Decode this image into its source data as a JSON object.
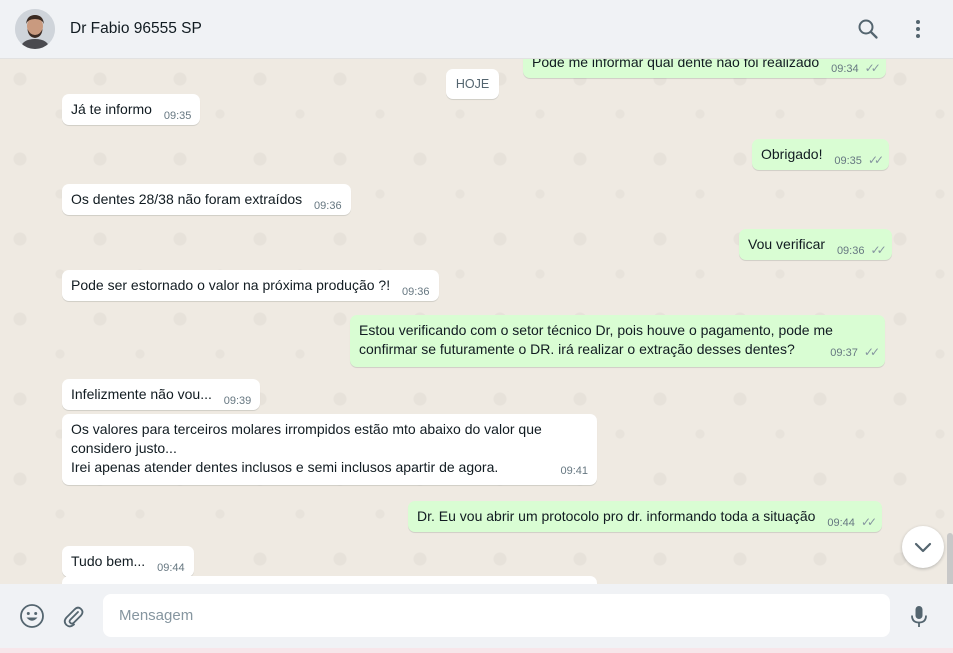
{
  "header": {
    "contact_name": "Dr Fabio 96555 SP"
  },
  "chat": {
    "date_chip": "HOJE",
    "top_partial_message": {
      "text": "Pode me informar qual dente não foi realizado",
      "time": "09:34"
    },
    "messages": [
      {
        "dir": "in",
        "text": "Já te informo",
        "time": "09:35"
      },
      {
        "dir": "out",
        "text": "Obrigado!",
        "time": "09:35"
      },
      {
        "dir": "in",
        "text": "Os dentes 28/38 não foram extraídos",
        "time": "09:36"
      },
      {
        "dir": "out",
        "text": "Vou verificar",
        "time": "09:36"
      },
      {
        "dir": "in",
        "text": "Pode ser estornado o valor na próxima produção ?!",
        "time": "09:36"
      },
      {
        "dir": "out",
        "line1": "Estou verificando com o setor técnico Dr, pois houve o pagamento, pode me",
        "line2": "confirmar se futuramente o DR. irá realizar o extração desses dentes?",
        "time": "09:37"
      },
      {
        "dir": "in",
        "text": "Infelizmente não vou...",
        "time": "09:39"
      },
      {
        "dir": "in",
        "line1": "Os valores para terceiros molares irrompidos estão mto abaixo do valor que",
        "line2": "considero justo...",
        "line3": "Irei apenas atender dentes inclusos e semi inclusos apartir de agora.",
        "time": "09:41"
      },
      {
        "dir": "out",
        "text": "Dr. Eu vou abrir um protocolo pro dr. informando toda a situação",
        "time": "09:44"
      },
      {
        "dir": "in",
        "text": "Tudo bem...",
        "time": "09:44"
      }
    ]
  },
  "composer": {
    "placeholder": "Mensagem"
  },
  "icons": {
    "search": "search-icon",
    "menu": "kebab-menu-icon",
    "emoji": "emoji-icon",
    "attach": "paperclip-icon",
    "mic": "microphone-icon",
    "scroll": "chevron-down-icon",
    "read": "double-check-icon"
  },
  "colors": {
    "incoming_bubble": "#ffffff",
    "outgoing_bubble": "#d9fdd3",
    "chat_background": "#efeae2",
    "header_background": "#f0f2f5"
  }
}
